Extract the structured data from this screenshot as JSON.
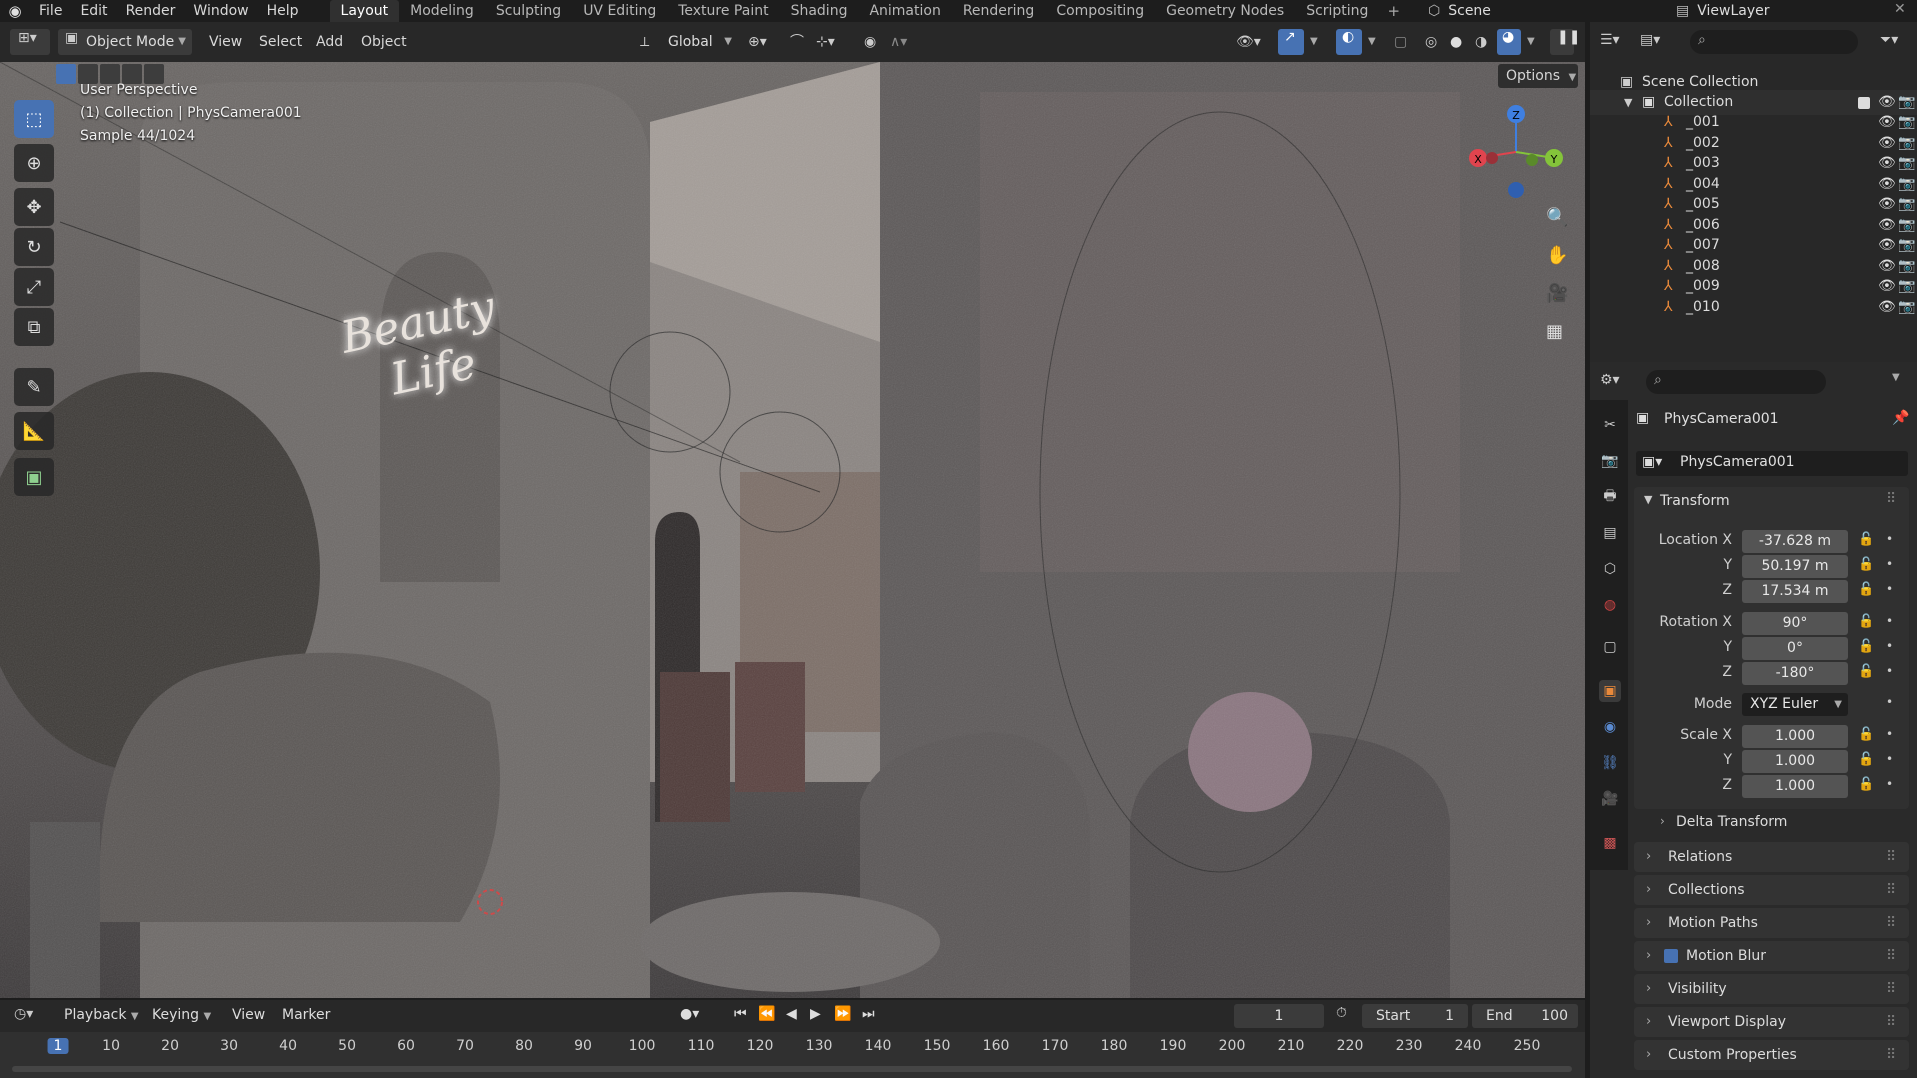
{
  "topbar": {
    "menus": [
      "File",
      "Edit",
      "Render",
      "Window",
      "Help"
    ],
    "workspaces": [
      "Layout",
      "Modeling",
      "Sculpting",
      "UV Editing",
      "Texture Paint",
      "Shading",
      "Animation",
      "Rendering",
      "Compositing",
      "Geometry Nodes",
      "Scripting"
    ],
    "active_workspace": "Layout",
    "scene": "Scene",
    "view_layer": "ViewLayer"
  },
  "viewport_header": {
    "mode": "Object Mode",
    "menus": [
      "View",
      "Select",
      "Add",
      "Object"
    ],
    "transform_orientation": "Global",
    "options": "Options"
  },
  "viewport": {
    "overlay_line1": "User Perspective",
    "overlay_line2": "(1) Collection | PhysCamera001",
    "overlay_line3": "Sample 44/1024",
    "sign_line1": "Beauty",
    "sign_line2": "Life",
    "gizmo": {
      "z": "Z",
      "x": "X",
      "y": "Y"
    }
  },
  "outliner": {
    "root": "Scene Collection",
    "collection": "Collection",
    "items": [
      "_001",
      "_002",
      "_003",
      "_004",
      "_005",
      "_006",
      "_007",
      "_008",
      "_009",
      "_010"
    ]
  },
  "properties": {
    "object_name": "PhysCamera001",
    "datablock": "PhysCamera001",
    "transform": {
      "title": "Transform",
      "location_label": "Location X",
      "location": [
        "-37.628 m",
        "50.197 m",
        "17.534 m"
      ],
      "rotation_label": "Rotation X",
      "rotation": [
        "90°",
        "0°",
        "-180°"
      ],
      "mode_label": "Mode",
      "mode": "XYZ Euler",
      "scale_label": "Scale X",
      "scale": [
        "1.000",
        "1.000",
        "1.000"
      ],
      "axis_y": "Y",
      "axis_z": "Z"
    },
    "delta_transform": "Delta Transform",
    "panels": [
      "Relations",
      "Collections",
      "Motion Paths",
      "Motion Blur",
      "Visibility",
      "Viewport Display",
      "Custom Properties"
    ]
  },
  "timeline": {
    "menus": [
      "Playback",
      "Keying",
      "View",
      "Marker"
    ],
    "current_frame": "1",
    "start_label": "Start",
    "start": "1",
    "end_label": "End",
    "end": "100",
    "ruler": [
      "1",
      "10",
      "20",
      "30",
      "40",
      "50",
      "60",
      "70",
      "80",
      "90",
      "100",
      "110",
      "120",
      "130",
      "140",
      "150",
      "160",
      "170",
      "180",
      "190",
      "200",
      "210",
      "220",
      "230",
      "240",
      "250"
    ]
  },
  "colors": {
    "accent": "#4772b3",
    "axis_x": "#e0444e",
    "axis_y": "#84c43a",
    "axis_z": "#3f7fe0",
    "object_orange": "#e8893b"
  }
}
